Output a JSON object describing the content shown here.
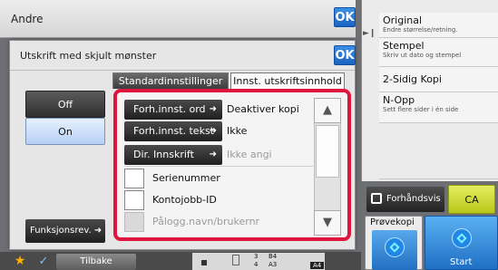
{
  "header": {
    "title": "Andre",
    "ok_label": "OK"
  },
  "side_panel": {
    "items": [
      {
        "title": "Original",
        "subtitle": "Endre størrelse/retning."
      },
      {
        "title": "Stempel",
        "subtitle": "Skriv ut dato og stempel"
      },
      {
        "title": "2-Sidig Kopi",
        "subtitle": ""
      },
      {
        "title": "N-Opp",
        "subtitle": "Sett flere sider i én side"
      }
    ]
  },
  "dialog": {
    "title": "Utskrift med skjult mønster",
    "ok_label": "OK",
    "tabs": [
      {
        "label": "Standardinnstillinger",
        "active": false
      },
      {
        "label": "Innst. utskriftsinnhold",
        "active": true
      }
    ],
    "toggle": {
      "off_label": "Off",
      "on_label": "On",
      "selected": "On"
    },
    "rows": [
      {
        "button": "Forh.innst. ord",
        "value": "Deaktiver kopi"
      },
      {
        "button": "Forh.innst. tekst",
        "value": "Ikke"
      },
      {
        "button": "Dir. Innskrift",
        "value": "Ikke angi"
      }
    ],
    "checkboxes": [
      {
        "label": "Serienummer",
        "checked": false,
        "enabled": true
      },
      {
        "label": "Kontojobb-ID",
        "checked": false,
        "enabled": true
      },
      {
        "label": "Pålogg.navn/brukernr",
        "checked": false,
        "enabled": false
      }
    ],
    "scroll": {
      "up_icon": "double-up-arrow",
      "down_icon": "double-down-arrow"
    },
    "funksjon_label": "Funksjonsrev."
  },
  "actions": {
    "preview_label": "Forhåndsvis",
    "ca_label": "CA",
    "proof_label": "Prøvekopi",
    "start_label": "Start"
  },
  "bottom": {
    "back_label": "Tilbake",
    "tray": {
      "row1_num": "3",
      "row1_size": "B4",
      "row2_num": "4",
      "row2_size": "A3",
      "selected_size": "A4"
    }
  },
  "colors": {
    "highlight_border": "#e0153d",
    "ok_blue": "#1a62c2",
    "ca_yellow": "#d2dc32",
    "start_blue": "#2a7fd6"
  }
}
